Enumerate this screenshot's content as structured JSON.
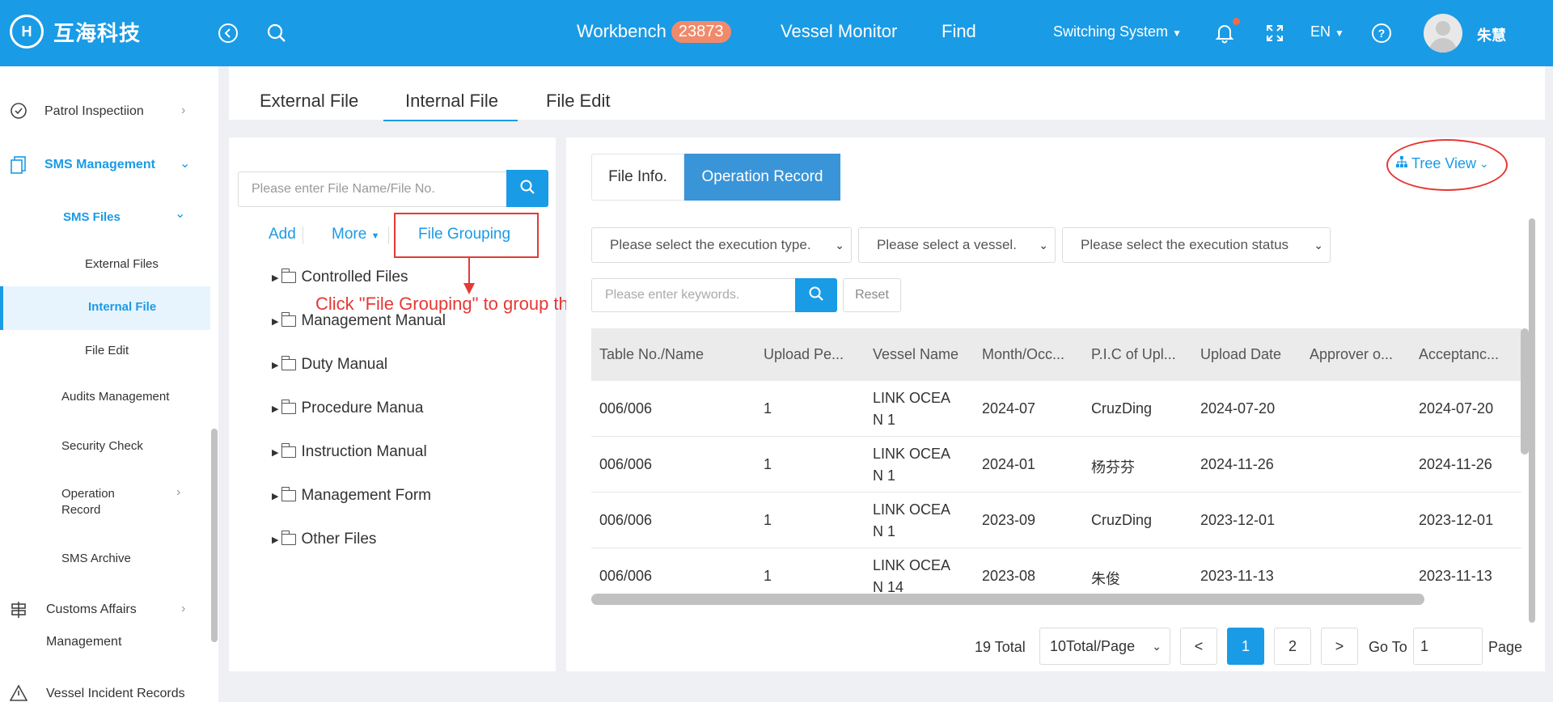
{
  "app": {
    "name": "互海科技",
    "logo_mark": "H"
  },
  "header": {
    "workbench_label": "Workbench",
    "workbench_badge": "23873",
    "vessel_monitor": "Vessel Monitor",
    "find": "Find",
    "switching_system": "Switching System",
    "language": "EN",
    "username": "朱慧"
  },
  "sidebar": {
    "patrol": "Patrol Inspectiion",
    "sms_management": "SMS Management",
    "sms_files": "SMS Files",
    "external_files": "External Files",
    "internal_file": "Internal File",
    "file_edit": "File Edit",
    "audits": "Audits Management",
    "security_check": "Security Check",
    "operation_record_1": "Operation",
    "operation_record_2": "Record",
    "sms_archive": "SMS Archive",
    "customs_1": "Customs Affairs",
    "customs_2": "Management",
    "vessel_incident": "Vessel Incident Records"
  },
  "tabs": [
    "External File",
    "Internal File",
    "File Edit"
  ],
  "left_panel": {
    "search_placeholder": "Please enter File Name/File No.",
    "add": "Add",
    "more": "More",
    "file_grouping": "File Grouping",
    "tree": [
      "Controlled Files",
      "Management Manual",
      "Duty Manual",
      "Procedure Manua",
      "Instruction Manual",
      "Management Form",
      "Other Files"
    ],
    "annotation": "Click \"File Grouping\" to group the system files"
  },
  "right_panel": {
    "seg_file_info": "File Info.",
    "seg_operation_record": "Operation Record",
    "tree_view": "Tree View",
    "select_exec_type": "Please select the execution type.",
    "select_vessel": "Please select a vessel.",
    "select_exec_status": "Please select the execution status",
    "keyword_placeholder": "Please enter keywords.",
    "reset": "Reset"
  },
  "table": {
    "headers": [
      "Table No./Name",
      "Upload Pe...",
      "Vessel Name",
      "Month/Occ...",
      "P.I.C of Upl...",
      "Upload Date",
      "Approver o...",
      "Acceptanc..."
    ],
    "rows": [
      {
        "no": "006/006",
        "period": "1",
        "vessel_1": "LINK OCEA",
        "vessel_2": "N 1",
        "month": "2024-07",
        "pic": "CruzDing",
        "upload": "2024-07-20",
        "approver": "",
        "accept": "2024-07-20"
      },
      {
        "no": "006/006",
        "period": "1",
        "vessel_1": "LINK OCEA",
        "vessel_2": "N 1",
        "month": "2024-01",
        "pic": "杨芬芬",
        "upload": "2024-11-26",
        "approver": "",
        "accept": "2024-11-26"
      },
      {
        "no": "006/006",
        "period": "1",
        "vessel_1": "LINK OCEA",
        "vessel_2": "N 1",
        "month": "2023-09",
        "pic": "CruzDing",
        "upload": "2023-12-01",
        "approver": "",
        "accept": "2023-12-01"
      },
      {
        "no": "006/006",
        "period": "1",
        "vessel_1": "LINK OCEA",
        "vessel_2": "N 14",
        "month": "2023-08",
        "pic": "朱俊",
        "upload": "2023-11-13",
        "approver": "",
        "accept": "2023-11-13"
      }
    ]
  },
  "pagination": {
    "total": "19 Total",
    "page_size": "10Total/Page",
    "prev": "<",
    "page_1": "1",
    "page_2": "2",
    "next": ">",
    "goto": "Go To",
    "goto_value": "1",
    "page_label": "Page"
  },
  "colors": {
    "primary": "#1a9be6",
    "annotation": "#e53935",
    "badge": "#f08a6b"
  }
}
